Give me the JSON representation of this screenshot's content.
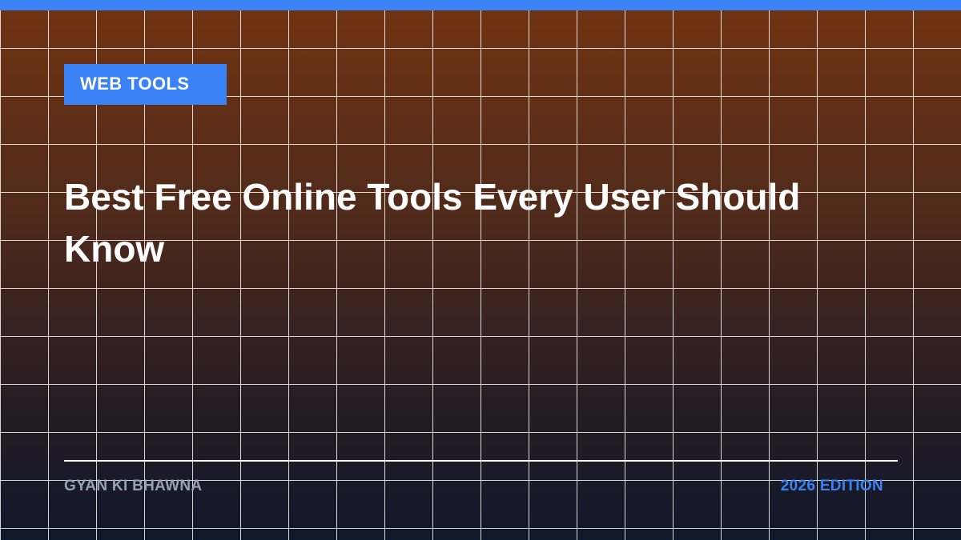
{
  "tag": {
    "label": "WEB TOOLS"
  },
  "headline": "Best Free Online Tools Every User Should Know",
  "footer": {
    "publisher": "GYAN KI BHAWNA",
    "edition": "2026 EDITION"
  },
  "colors": {
    "accent": "#3b82f6",
    "publisher_text": "#94a3b8",
    "bg_top": "#723412",
    "bg_bottom": "#10182b"
  }
}
